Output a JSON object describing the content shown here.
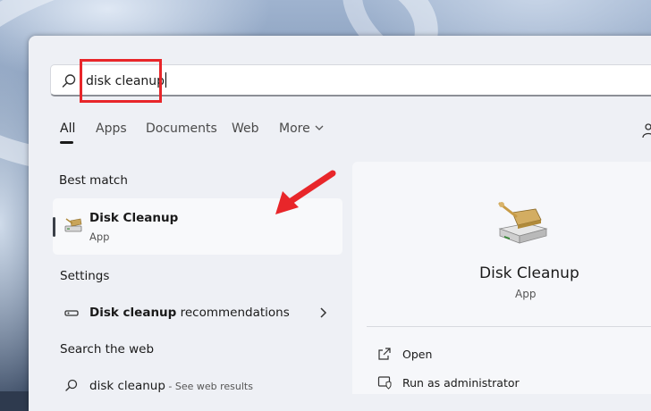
{
  "search": {
    "query": "disk cleanup"
  },
  "tabs": [
    {
      "label": "All"
    },
    {
      "label": "Apps"
    },
    {
      "label": "Documents"
    },
    {
      "label": "Web"
    },
    {
      "label": "More"
    }
  ],
  "best_match": {
    "heading": "Best match",
    "name": "Disk Cleanup",
    "type": "App"
  },
  "settings": {
    "heading": "Settings",
    "item_bold": "Disk cleanup",
    "item_rest": " recommendations"
  },
  "web": {
    "heading": "Search the web",
    "query": "disk cleanup",
    "suffix": " - See web results"
  },
  "detail": {
    "name": "Disk Cleanup",
    "type": "App",
    "actions": [
      {
        "label": "Open",
        "icon": "open-external-icon"
      },
      {
        "label": "Run as administrator",
        "icon": "shield-admin-icon"
      }
    ]
  },
  "colors": {
    "highlight": "#e8262a",
    "arrow": "#e8262a",
    "panel": "#eef0f5"
  }
}
